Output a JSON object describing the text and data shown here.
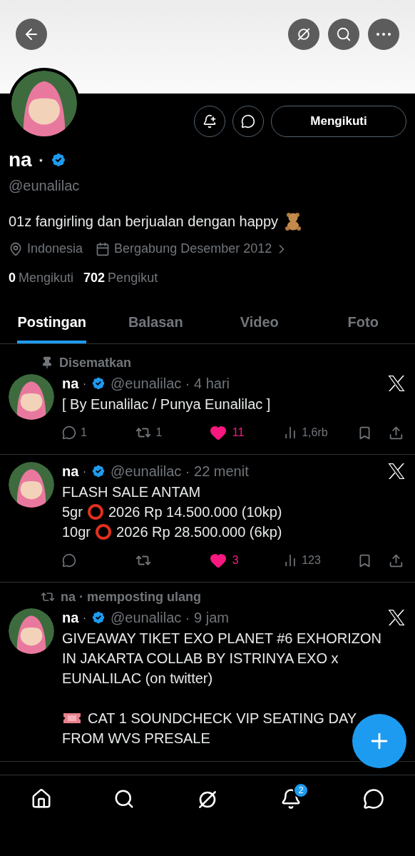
{
  "profile": {
    "name": "na",
    "name_mark": "⋆",
    "verified": true,
    "handle": "@eunalilac",
    "bio": "01z fangirling dan berjualan dengan happy",
    "location": "Indonesia",
    "joined": "Bergabung Desember 2012",
    "following_count": "0",
    "following_label": "Mengikuti",
    "followers_count": "702",
    "followers_label": "Pengikut",
    "follow_button": "Mengikuti"
  },
  "tabs": [
    {
      "label": "Postingan",
      "selected": true
    },
    {
      "label": "Balasan",
      "selected": false
    },
    {
      "label": "Video",
      "selected": false
    },
    {
      "label": "Foto",
      "selected": false
    }
  ],
  "posts": [
    {
      "context": {
        "kind": "pinned",
        "text": "Disematkan"
      },
      "name": "na",
      "name_mark": "·",
      "verified": true,
      "meta": "@eunalilac · 4 hari",
      "paragraphs": [
        [
          [
            {
              "kind": "text",
              "text": "[ By Eunalilac / Punya Eunalilac ]"
            }
          ]
        ]
      ],
      "replies": "1",
      "reposts": "1",
      "likes": "11",
      "liked": true,
      "views": "1,6rb"
    },
    {
      "name": "na",
      "name_mark": "·",
      "verified": true,
      "meta": "@eunalilac · 22 menit",
      "paragraphs": [
        [
          [
            {
              "kind": "text",
              "text": "FLASH SALE ANTAM"
            }
          ],
          [
            {
              "kind": "text",
              "text": "5gr"
            },
            {
              "kind": "ring"
            },
            {
              "kind": "text",
              "text": "2026 Rp 14.500.000 (10kp)"
            }
          ],
          [
            {
              "kind": "text",
              "text": "10gr"
            },
            {
              "kind": "ring"
            },
            {
              "kind": "text",
              "text": "2026 Rp 28.500.000 (6kp)"
            }
          ]
        ]
      ],
      "likes": "3",
      "liked": true,
      "views": "123"
    },
    {
      "context": {
        "kind": "repost",
        "text": "na · memposting ulang"
      },
      "name": "na",
      "name_mark": "·",
      "verified": true,
      "meta": "@eunalilac · 9 jam",
      "paragraphs": [
        [
          [
            {
              "kind": "text",
              "text": "GIVEAWAY TIKET EXO PLANET #6 EXHORIZON"
            }
          ],
          [
            {
              "kind": "text",
              "text": "IN JAKARTA COLLAB BY ISTRINYA EXO x"
            }
          ],
          [
            {
              "kind": "text",
              "text": "EUNALILAC (on twitter)"
            }
          ]
        ],
        [
          [
            {
              "kind": "ticket"
            },
            {
              "kind": "text",
              "text": "CAT 1 SOUNDCHECK VIP SEATING DAY"
            }
          ],
          [
            {
              "kind": "text",
              "text": "FROM WVS PRESALE"
            }
          ]
        ]
      ]
    }
  ],
  "notifications_badge": "2"
}
